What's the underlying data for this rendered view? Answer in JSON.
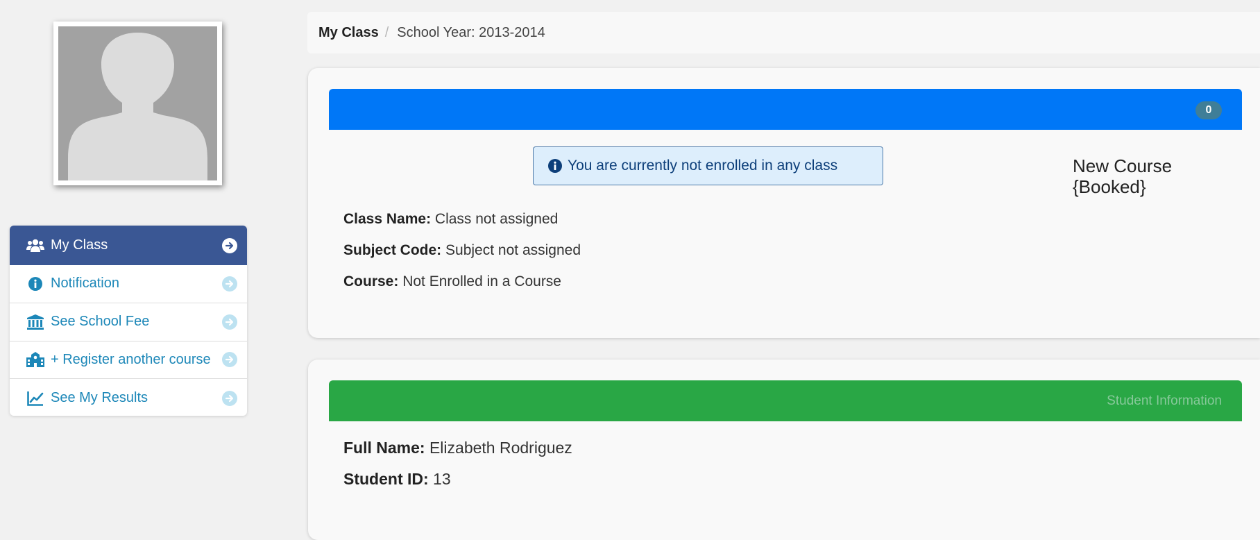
{
  "sidebar": {
    "items": [
      {
        "label": "My Class",
        "icon": "users-icon",
        "active": true
      },
      {
        "label": "Notification",
        "icon": "info-circle-icon",
        "active": false
      },
      {
        "label": "See School Fee",
        "icon": "bank-icon",
        "active": false
      },
      {
        "label": "+ Register another course",
        "icon": "school-icon",
        "active": false
      },
      {
        "label": "See My Results",
        "icon": "line-chart-icon",
        "active": false
      }
    ]
  },
  "breadcrumb": {
    "current": "My Class",
    "separator": "/",
    "school_year": "School Year: 2013-2014"
  },
  "class_card": {
    "badge_count": "0",
    "alert_text": "You are currently not enrolled in any class",
    "new_course_line1": "New Course",
    "new_course_line2": "{Booked}",
    "fields": [
      {
        "label": "Class Name:",
        "value": "Class not assigned"
      },
      {
        "label": "Subject Code:",
        "value": "Subject not assigned"
      },
      {
        "label": "Course:",
        "value": "Not Enrolled in a Course"
      }
    ]
  },
  "student_card": {
    "header_title": "Student Information",
    "fields": [
      {
        "label": "Full Name:",
        "value": "Elizabeth Rodriguez"
      },
      {
        "label": "Student ID:",
        "value": "13"
      }
    ]
  },
  "colors": {
    "menu_active": "#3a5794",
    "menu_link": "#1c87b8",
    "class_header": "#0077f7",
    "student_header": "#29a745",
    "badge": "#3f7e98",
    "alert_bg": "#ddeefc"
  }
}
